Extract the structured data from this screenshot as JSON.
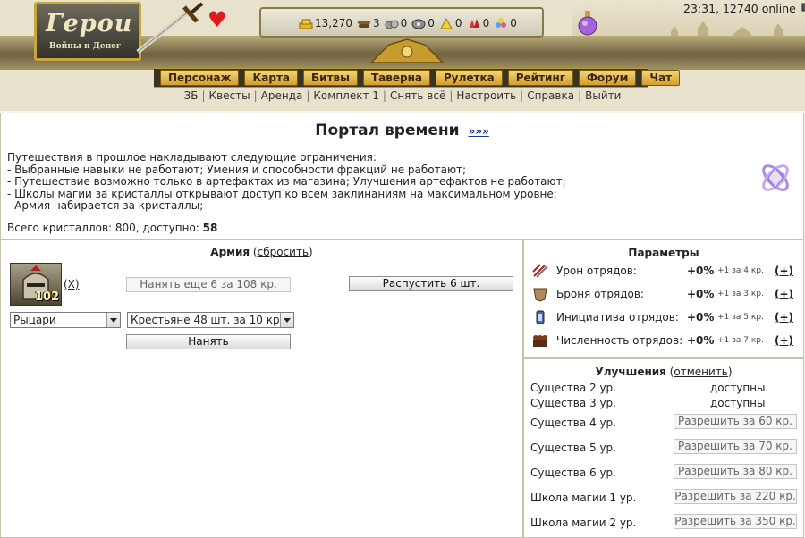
{
  "header": {
    "logo_title": "Герои",
    "logo_subtitle": "Войны и Денег",
    "resources": [
      {
        "icon": "gold-icon",
        "value": "13,270"
      },
      {
        "icon": "wood-icon",
        "value": "3"
      },
      {
        "icon": "ore-icon",
        "value": "0"
      },
      {
        "icon": "mercury-icon",
        "value": "0"
      },
      {
        "icon": "sulfur-icon",
        "value": "0"
      },
      {
        "icon": "crystal-icon",
        "value": "0"
      },
      {
        "icon": "gems-icon",
        "value": "0"
      }
    ],
    "online_status": "23:31, 12740 online",
    "menu": [
      "Персонаж",
      "Карта",
      "Битвы",
      "Таверна",
      "Рулетка",
      "Рейтинг",
      "Форум",
      "Чат"
    ],
    "sub_links": [
      "ЗБ",
      "Квесты",
      "Аренда",
      "Комплект 1",
      "Снять всё",
      "Настроить",
      "Справка",
      "Выйти"
    ]
  },
  "portal": {
    "title": "Портал времени",
    "more_link": "»»»",
    "lines": [
      "Путешествия в прошлое накладывают следующие ограничения:",
      "- Выбранные навыки не работают; Умения и способности фракций не работают;",
      "- Путешествие возможно только в артефактах из магазина; Улучшения артефактов не работают;",
      "- Школы магии за кристаллы открывают доступ ко всем заклинаниям на максимальном уровне;",
      "- Армия набирается за кристаллы;"
    ],
    "crystals_label": "Всего кристаллов: 800, доступно:",
    "crystals_available": "58"
  },
  "army": {
    "title": "Армия",
    "reset_link": "сбросить",
    "unit_count": "102",
    "remove_link": "(X)",
    "hire_more_label": "Нанять еще 6 за 108 кр.",
    "dismiss_label": "Распустить 6 шт.",
    "faction_selected": "Рыцари",
    "unit_selected": "Крестьяне 48 шт. за 10 кр.",
    "hire_label": "Нанять"
  },
  "params": {
    "title": "Параметры",
    "rows": [
      {
        "label": "Урон отрядов:",
        "value": "+0%",
        "cost": "+1 за 4 кр.",
        "plus": "(+)"
      },
      {
        "label": "Броня отрядов:",
        "value": "+0%",
        "cost": "+1 за 3 кр.",
        "plus": "(+)"
      },
      {
        "label": "Инициатива отрядов:",
        "value": "+0%",
        "cost": "+1 за 5 кр.",
        "plus": "(+)"
      },
      {
        "label": "Численность отрядов:",
        "value": "+0%",
        "cost": "+1 за 7 кр.",
        "plus": "(+)"
      }
    ]
  },
  "upgrades": {
    "title": "Улучшения",
    "cancel_link": "отменить",
    "rows": [
      {
        "label": "Существа 2 ур.",
        "status": "доступны"
      },
      {
        "label": "Существа 3 ур.",
        "status": "доступны"
      },
      {
        "label": "Существа 4 ур.",
        "button": "Разрешить за 60 кр."
      },
      {
        "label": "Существа 5 ур.",
        "button": "Разрешить за 70 кр."
      },
      {
        "label": "Существа 6 ур.",
        "button": "Разрешить за 80 кр."
      },
      {
        "label": "Школа магии 1 ур.",
        "button": "Разрешить за 220 кр."
      },
      {
        "label": "Школа магии 2 ур.",
        "button": "Разрешить за 350 кр."
      }
    ]
  }
}
